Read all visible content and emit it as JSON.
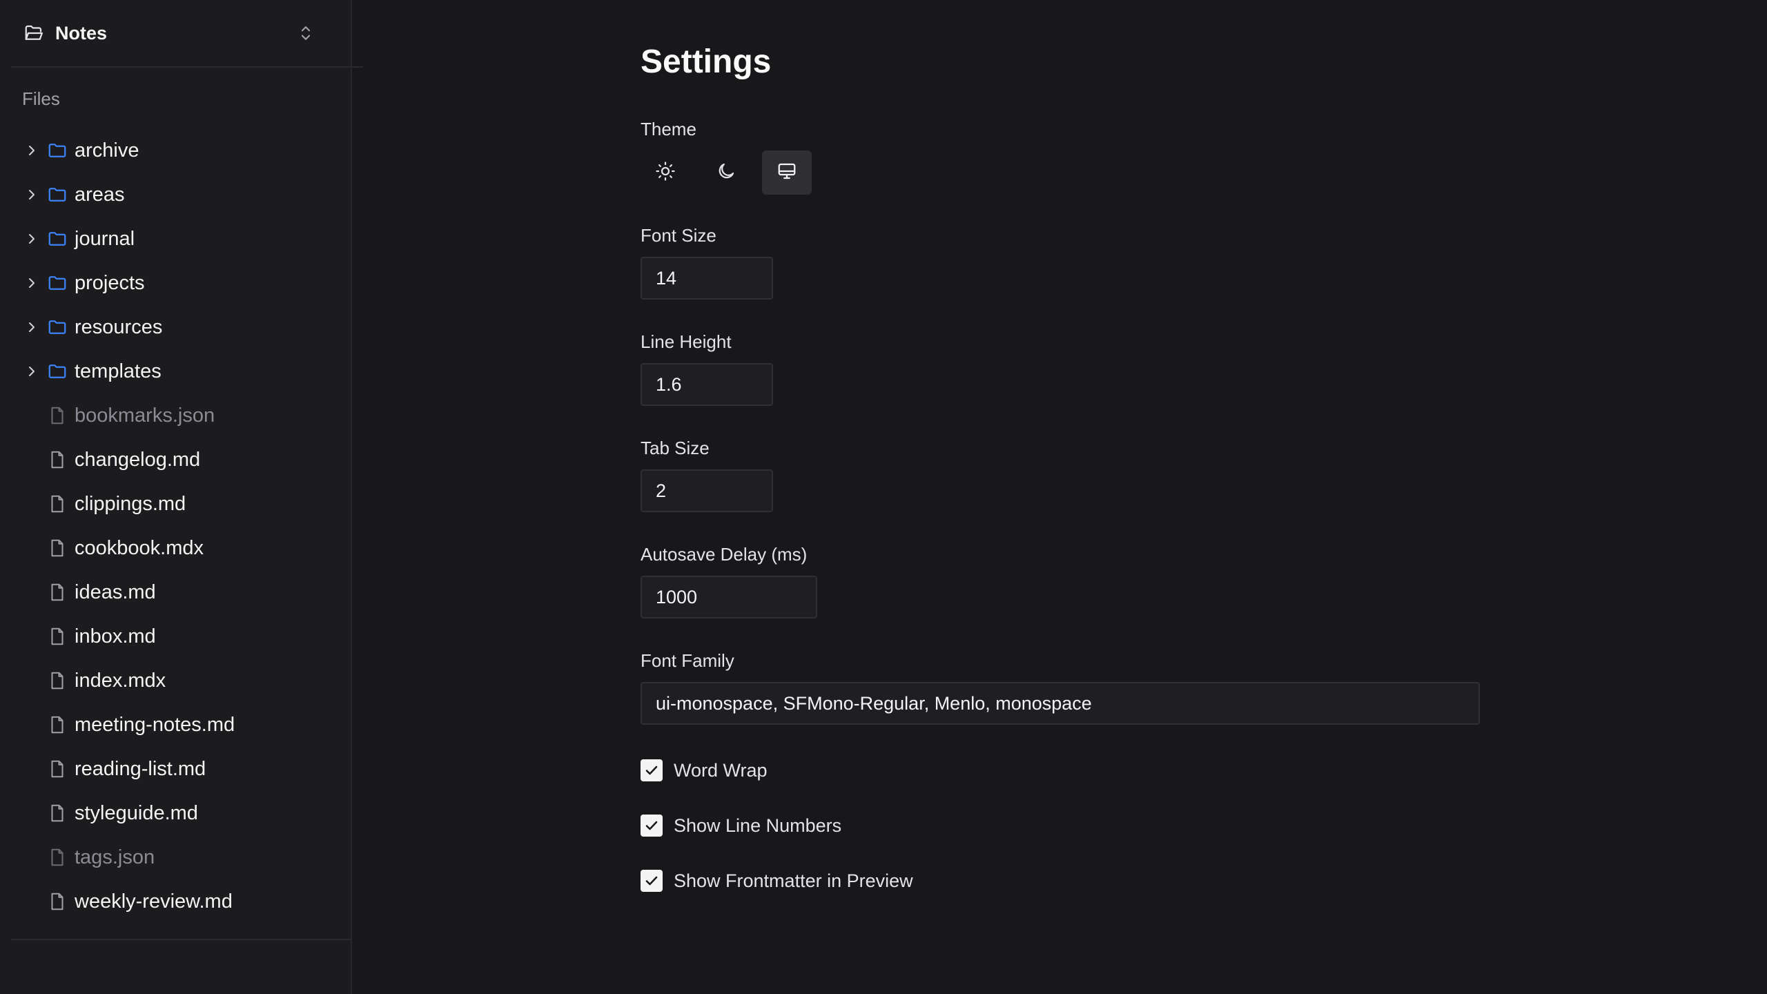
{
  "sidebar": {
    "vault": {
      "name": "Notes"
    },
    "section_label": "Files",
    "items": [
      {
        "type": "folder",
        "label": "archive",
        "icon": "folder-icon"
      },
      {
        "type": "folder",
        "label": "areas",
        "icon": "folder-icon"
      },
      {
        "type": "folder",
        "label": "journal",
        "icon": "folder-icon"
      },
      {
        "type": "folder",
        "label": "projects",
        "icon": "folder-icon"
      },
      {
        "type": "folder",
        "label": "resources",
        "icon": "folder-icon"
      },
      {
        "type": "folder",
        "label": "templates",
        "icon": "folder-icon"
      },
      {
        "type": "file",
        "label": "bookmarks.json",
        "icon": "file-icon",
        "dimmed": true
      },
      {
        "type": "file",
        "label": "changelog.md",
        "icon": "file-icon"
      },
      {
        "type": "file",
        "label": "clippings.md",
        "icon": "file-icon"
      },
      {
        "type": "file",
        "label": "cookbook.mdx",
        "icon": "file-icon"
      },
      {
        "type": "file",
        "label": "ideas.md",
        "icon": "file-icon"
      },
      {
        "type": "file",
        "label": "inbox.md",
        "icon": "file-icon"
      },
      {
        "type": "file",
        "label": "index.mdx",
        "icon": "file-icon"
      },
      {
        "type": "file",
        "label": "meeting-notes.md",
        "icon": "file-icon"
      },
      {
        "type": "file",
        "label": "reading-list.md",
        "icon": "file-icon"
      },
      {
        "type": "file",
        "label": "styleguide.md",
        "icon": "file-icon"
      },
      {
        "type": "file",
        "label": "tags.json",
        "icon": "file-icon",
        "dimmed": true
      },
      {
        "type": "file",
        "label": "weekly-review.md",
        "icon": "file-icon"
      }
    ]
  },
  "settings": {
    "title": "Settings",
    "theme": {
      "label": "Theme",
      "options": [
        "sun-icon",
        "moon-icon",
        "monitor-icon"
      ],
      "selected": "monitor-icon"
    },
    "font_size": {
      "label": "Font Size",
      "value": "14"
    },
    "line_height": {
      "label": "Line Height",
      "value": "1.6"
    },
    "tab_size": {
      "label": "Tab Size",
      "value": "2"
    },
    "autosave_delay": {
      "label": "Autosave Delay (ms)",
      "value": "1000"
    },
    "font_family": {
      "label": "Font Family",
      "value": "ui-monospace, SFMono-Regular, Menlo, monospace"
    },
    "word_wrap": {
      "label": "Word Wrap",
      "checked": true
    },
    "show_line_numbers": {
      "label": "Show Line Numbers",
      "checked": true
    },
    "show_frontmatter": {
      "label": "Show Frontmatter in Preview",
      "checked": true
    }
  },
  "colors": {
    "background": "#18181b",
    "sidebar": "#1c1c1f",
    "folder_icon": "#3b82f6",
    "text": "#f4f4f5",
    "muted": "#a1a1aa",
    "dimmed_file": "#8b8b94"
  }
}
